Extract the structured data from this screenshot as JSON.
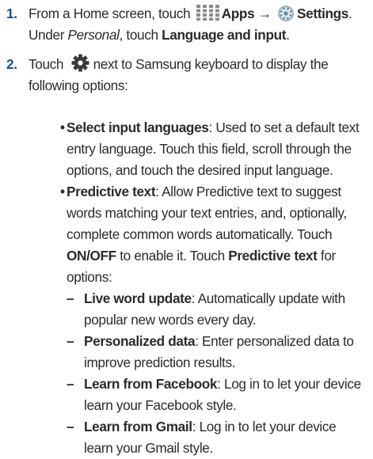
{
  "step1": {
    "number": "1.",
    "pre": "From a Home screen, touch",
    "apps": "Apps",
    "arrow": "→",
    "settings": "Settings",
    "period": ".",
    "under": "Under",
    "personal": "Personal",
    "comma_touch": ", touch",
    "lang_input": "Language and input",
    "end": "."
  },
  "step2": {
    "number": "2.",
    "pre": "Touch",
    "post_line1": "next to Samsung keyboard to display the",
    "post_line2": "following options:"
  },
  "bullets": [
    {
      "title": "Select input languages",
      "desc": ": Used to set a default text entry language. Touch this field, scroll through the options, and touch the desired input language."
    },
    {
      "title": "Predictive text",
      "desc": ": Allow Predictive text to suggest words matching your text entries, and, optionally, complete common words automatically. Touch ",
      "onoff": "ON/OFF",
      "mid": " to enable it. Touch ",
      "title2": "Predictive text",
      "end": " for options:"
    }
  ],
  "subitems": [
    {
      "mark": "–",
      "title": "Live word update",
      "desc": ": Automatically update with popular new words every day."
    },
    {
      "mark": "–",
      "title": "Personalized data",
      "desc": ": Enter personalized data to improve prediction results."
    },
    {
      "mark": "–",
      "title": "Learn from Facebook",
      "desc": ": Log in to let your device learn your Facebook style."
    },
    {
      "mark": "–",
      "title": "Learn from Gmail",
      "desc": ": Log in to let your device learn your Gmail style."
    }
  ],
  "icons": {
    "apps": "apps-grid-icon",
    "settings": "settings-icon",
    "gear": "gear-icon"
  },
  "colors": {
    "number": "#1b4f8f",
    "text": "#2b2b2b"
  }
}
